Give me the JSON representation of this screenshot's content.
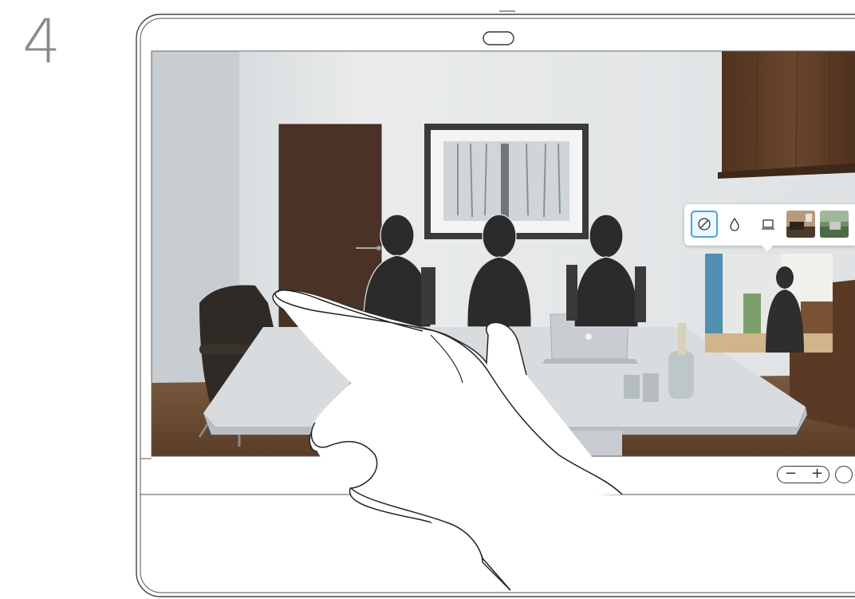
{
  "step": {
    "number": "4"
  },
  "background_menu": {
    "options": [
      {
        "name": "none",
        "icon": "block-icon",
        "selected": true
      },
      {
        "name": "blur",
        "icon": "droplet-icon",
        "selected": false
      },
      {
        "name": "screen",
        "icon": "monitor-icon",
        "selected": false
      },
      {
        "name": "living-room",
        "icon": "image-thumbnail",
        "selected": false
      },
      {
        "name": "nature",
        "icon": "image-thumbnail",
        "selected": false
      }
    ]
  },
  "controls": {
    "minus": "−",
    "plus": "+"
  },
  "colors": {
    "selected_border": "#3fa6e6",
    "door": "#4a3226",
    "wall": "#e6e8e9",
    "table": "#d8dcdf",
    "silhouette": "#2b2b2b",
    "cabinet": "#5a3a25"
  }
}
